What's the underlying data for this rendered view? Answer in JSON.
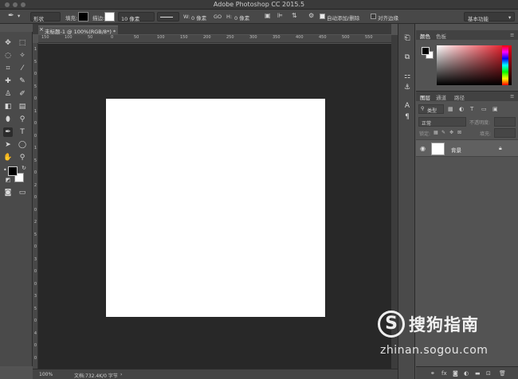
{
  "app": {
    "window_title": "Adobe Photoshop CC 2015.5"
  },
  "options_bar": {
    "mode": "形状",
    "fill_label": "填充:",
    "stroke_label": "描边:",
    "stroke_size": "10 像素",
    "w_label": "W:",
    "w_value": "0 像素",
    "link_icon": "GO",
    "h_label": "H:",
    "h_value": "0 像素",
    "auto_add_delete": "自动添加/删除",
    "align_edges": "对齐边缘",
    "workspace": "基本功能",
    "fill_color": "#000000",
    "stroke_color": "#ffffff"
  },
  "document": {
    "tab_label": "未标题-1 @ 100%(RGB/8*) *",
    "background": "#ffffff"
  },
  "ruler": {
    "h_labels": [
      "150",
      "100",
      "50",
      "0",
      "50",
      "100",
      "150",
      "200",
      "250",
      "300",
      "350",
      "400",
      "450",
      "500",
      "550"
    ],
    "v_labels": [
      "1",
      "5",
      "0",
      "5",
      "0",
      "1",
      "0",
      "0",
      "1",
      "5",
      "0",
      "2",
      "0",
      "0",
      "2",
      "5",
      "0",
      "3",
      "0",
      "0",
      "3",
      "5",
      "0",
      "4",
      "0",
      "0"
    ]
  },
  "status": {
    "zoom": "100%",
    "doc_info": "文档:732.4K/0 字节"
  },
  "color_panel": {
    "tabs": [
      "颜色",
      "色板"
    ],
    "fg": "#000000",
    "bg": "#ffffff"
  },
  "layers_panel": {
    "tabs": [
      "图层",
      "通道",
      "路径"
    ],
    "filter_kind": "类型",
    "blend_mode": "正常",
    "opacity_label": "不透明度:",
    "lock_label": "锁定:",
    "fill_label": "填充:",
    "layers": [
      {
        "name": "背景",
        "visible": true,
        "locked": true
      }
    ]
  },
  "watermark": {
    "logo_letter": "S",
    "text_cn": "搜狗指南",
    "url": "zhinan.sogou.com"
  }
}
